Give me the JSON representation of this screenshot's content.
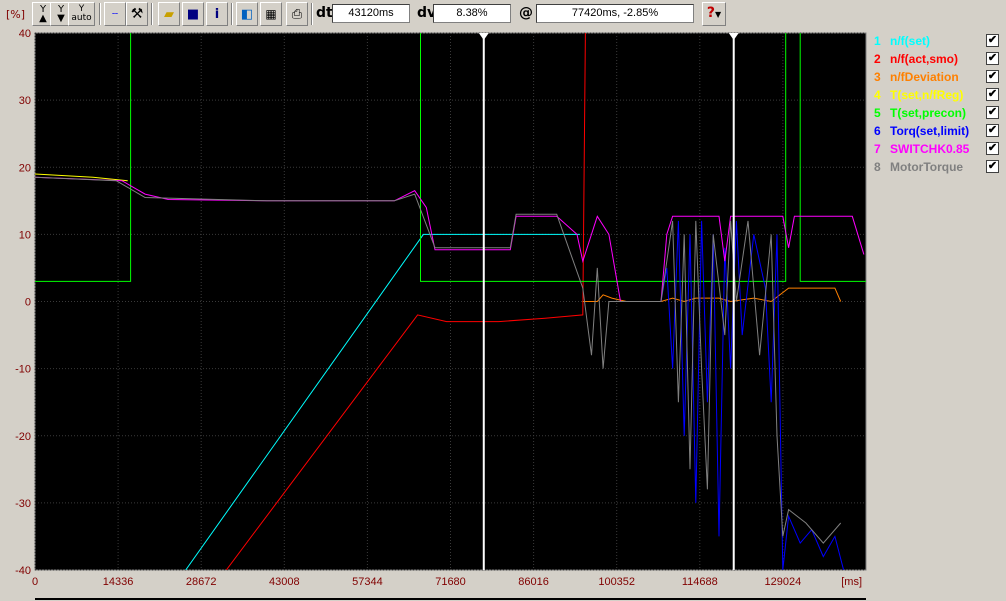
{
  "toolbar": {
    "unit_label": "[%]",
    "y_up_label": "Y",
    "y_down_label": "Y",
    "y_auto_label": "Y auto",
    "dt_label": "dt",
    "dt_value": "43120ms",
    "dv_label": "dv",
    "dv_value": "8.38%",
    "at_label": "@",
    "at_value": "77420ms, -2.85%",
    "help_label": "?"
  },
  "icons": {
    "y_up": "y-zoom-up-icon",
    "y_down": "y-zoom-down-icon",
    "grid": "grid-icon",
    "tools": "tools-icon",
    "open": "folder-open-icon",
    "save": "floppy-disk-icon",
    "info": "info-icon",
    "export": "export-icon",
    "table": "table-icon",
    "print": "printer-icon",
    "help": "help-icon"
  },
  "colors": {
    "plot_bg": "#000000",
    "grid": "#3a3a3a",
    "cursor": "#ffffff",
    "tick_text": "#800000"
  },
  "legend": [
    {
      "num": "1",
      "name": "n/f(set)",
      "color": "#00ffff",
      "checked": true
    },
    {
      "num": "2",
      "name": "n/f(act,smo)",
      "color": "#ff0000",
      "checked": true
    },
    {
      "num": "3",
      "name": "n/fDeviation",
      "color": "#ff8000",
      "checked": true
    },
    {
      "num": "4",
      "name": "T(set,n/fReg)",
      "color": "#ffff00",
      "checked": true
    },
    {
      "num": "5",
      "name": "T(set,precon)",
      "color": "#00ff00",
      "checked": true
    },
    {
      "num": "6",
      "name": "Torq(set,limit)",
      "color": "#0000ff",
      "checked": true
    },
    {
      "num": "7",
      "name": "SWITCHK0.85",
      "color": "#ff00ff",
      "checked": true
    },
    {
      "num": "8",
      "name": "MotorTorque",
      "color": "#808080",
      "checked": true
    }
  ],
  "chart_data": {
    "type": "line",
    "xlabel": "[ms]",
    "ylabel": "[%]",
    "xlim": [
      0,
      143360
    ],
    "ylim": [
      -40,
      40
    ],
    "x_ticks": [
      0,
      14336,
      28672,
      43008,
      57344,
      71680,
      86016,
      100352,
      114688,
      129024
    ],
    "y_ticks": [
      40,
      30,
      20,
      10,
      0,
      -10,
      -20,
      -30,
      -40
    ],
    "grid": true,
    "cursors_ms": [
      77420,
      120540
    ],
    "series": [
      {
        "name": "n/f(set)",
        "color": "#00ffff",
        "points": [
          [
            26000,
            -40
          ],
          [
            67000,
            10
          ],
          [
            94000,
            10
          ]
        ]
      },
      {
        "name": "n/f(act,smo)",
        "color": "#ff0000",
        "points": [
          [
            33000,
            -40
          ],
          [
            66000,
            -2
          ],
          [
            71000,
            -3
          ],
          [
            80000,
            -3
          ],
          [
            88000,
            -2.5
          ],
          [
            94500,
            -2
          ],
          [
            95000,
            45
          ]
        ]
      },
      {
        "name": "n/fDeviation",
        "color": "#ff8000",
        "points": [
          [
            94500,
            0
          ],
          [
            97000,
            0
          ],
          [
            98000,
            1
          ],
          [
            99500,
            0.5
          ],
          [
            102000,
            0
          ],
          [
            108000,
            0
          ],
          [
            110000,
            0.5
          ],
          [
            112000,
            0
          ],
          [
            114000,
            0.5
          ],
          [
            118000,
            0.5
          ],
          [
            120000,
            0
          ],
          [
            124000,
            0.5
          ],
          [
            127000,
            0
          ],
          [
            130000,
            2
          ],
          [
            138000,
            2
          ],
          [
            139000,
            0
          ]
        ]
      },
      {
        "name": "T(set,n/fReg)",
        "color": "#ffff00",
        "points": [
          [
            0,
            19
          ],
          [
            10000,
            18.5
          ],
          [
            16000,
            18
          ]
        ]
      },
      {
        "name": "T(set,precon)",
        "color": "#00ff00",
        "points": [
          [
            0,
            3
          ],
          [
            16500,
            3
          ],
          [
            16500,
            45
          ],
          [
            66500,
            45
          ],
          [
            66500,
            3
          ],
          [
            129500,
            3
          ],
          [
            129500,
            45
          ],
          [
            132000,
            45
          ],
          [
            132000,
            3
          ],
          [
            143360,
            3
          ]
        ]
      },
      {
        "name": "Torq(set,limit)",
        "color": "#0000ff",
        "points": [
          [
            108000,
            0
          ],
          [
            109000,
            5
          ],
          [
            110000,
            -10
          ],
          [
            111000,
            12
          ],
          [
            112000,
            -20
          ],
          [
            113000,
            10
          ],
          [
            114000,
            -30
          ],
          [
            115000,
            12
          ],
          [
            116000,
            -15
          ],
          [
            117000,
            10
          ],
          [
            118000,
            -35
          ],
          [
            119000,
            8
          ],
          [
            120000,
            -10
          ],
          [
            121000,
            12
          ],
          [
            122000,
            -5
          ],
          [
            124000,
            10
          ],
          [
            126000,
            2
          ],
          [
            127000,
            -15
          ],
          [
            128000,
            10
          ],
          [
            129000,
            -40
          ],
          [
            130000,
            -32
          ],
          [
            132000,
            -36
          ],
          [
            134000,
            -34
          ],
          [
            136000,
            -38
          ],
          [
            138000,
            -35
          ],
          [
            139500,
            -40
          ]
        ]
      },
      {
        "name": "SWITCHK0.85",
        "color": "#ff00ff",
        "points": [
          [
            0,
            18.5
          ],
          [
            15000,
            18
          ],
          [
            19000,
            16
          ],
          [
            23000,
            15.2
          ],
          [
            40000,
            15
          ],
          [
            62000,
            15
          ],
          [
            65500,
            16.5
          ],
          [
            67500,
            14
          ],
          [
            69000,
            7.7
          ],
          [
            82000,
            7.7
          ],
          [
            83000,
            12.7
          ],
          [
            90000,
            12.7
          ],
          [
            93500,
            10
          ],
          [
            94500,
            6
          ],
          [
            97000,
            12.7
          ],
          [
            99000,
            10
          ],
          [
            101000,
            0
          ],
          [
            106000,
            0
          ],
          [
            108000,
            0
          ],
          [
            109000,
            10
          ],
          [
            110000,
            12.7
          ],
          [
            118000,
            12.7
          ],
          [
            119000,
            6
          ],
          [
            120000,
            12.7
          ],
          [
            129000,
            12.7
          ],
          [
            130000,
            8
          ],
          [
            131000,
            12.7
          ],
          [
            141000,
            12.7
          ],
          [
            143000,
            7
          ]
        ]
      },
      {
        "name": "MotorTorque",
        "color": "#808080",
        "points": [
          [
            0,
            18.5
          ],
          [
            14000,
            18
          ],
          [
            19000,
            15.5
          ],
          [
            40000,
            15
          ],
          [
            62000,
            15
          ],
          [
            65500,
            16
          ],
          [
            69000,
            8
          ],
          [
            82000,
            8
          ],
          [
            83000,
            13
          ],
          [
            90000,
            13
          ],
          [
            94500,
            2
          ],
          [
            96000,
            -8
          ],
          [
            97000,
            5
          ],
          [
            98000,
            -10
          ],
          [
            99000,
            0
          ],
          [
            108000,
            0
          ],
          [
            110000,
            12
          ],
          [
            111000,
            -15
          ],
          [
            112000,
            10
          ],
          [
            113000,
            -25
          ],
          [
            114000,
            12
          ],
          [
            115000,
            -10
          ],
          [
            116000,
            -28
          ],
          [
            117000,
            10
          ],
          [
            119000,
            -5
          ],
          [
            120000,
            12
          ],
          [
            121000,
            0
          ],
          [
            123000,
            12
          ],
          [
            125000,
            -8
          ],
          [
            127000,
            10
          ],
          [
            128000,
            -20
          ],
          [
            129000,
            -35
          ],
          [
            130000,
            -31
          ],
          [
            133000,
            -33
          ],
          [
            136000,
            -36
          ],
          [
            139000,
            -33
          ]
        ]
      }
    ]
  }
}
